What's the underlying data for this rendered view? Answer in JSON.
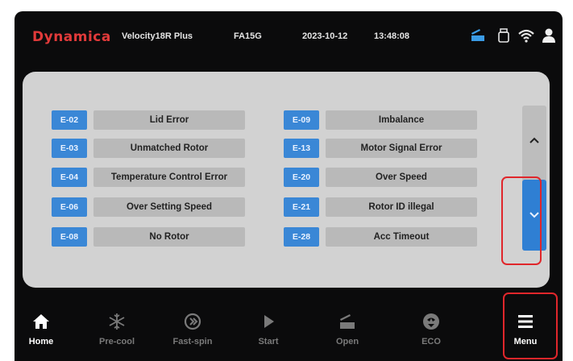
{
  "status_bar": {
    "brand": "Dynamica",
    "model": "Velocity18R Plus",
    "rotor": "FA15G",
    "date": "2023-10-12",
    "time": "13:48:08",
    "icons": [
      "lid-open-icon",
      "usb-icon",
      "wifi-icon",
      "user-icon"
    ]
  },
  "errors": {
    "left": [
      {
        "code": "E-02",
        "label": "Lid Error"
      },
      {
        "code": "E-03",
        "label": "Unmatched Rotor"
      },
      {
        "code": "E-04",
        "label": "Temperature Control Error"
      },
      {
        "code": "E-06",
        "label": "Over Setting Speed"
      },
      {
        "code": "E-08",
        "label": "No Rotor"
      }
    ],
    "right": [
      {
        "code": "E-09",
        "label": "Imbalance"
      },
      {
        "code": "E-13",
        "label": "Motor Signal Error"
      },
      {
        "code": "E-20",
        "label": "Over Speed"
      },
      {
        "code": "E-21",
        "label": "Rotor ID illegal"
      },
      {
        "code": "E-28",
        "label": "Acc Timeout"
      }
    ]
  },
  "scroll": {
    "up_icon": "chevron-up-icon",
    "down_icon": "chevron-down-icon"
  },
  "nav": [
    {
      "label": "Home",
      "icon": "home-icon",
      "active": true
    },
    {
      "label": "Pre-cool",
      "icon": "snowflake-icon",
      "active": false
    },
    {
      "label": "Fast-spin",
      "icon": "fast-spin-icon",
      "active": false
    },
    {
      "label": "Start",
      "icon": "play-icon",
      "active": false
    },
    {
      "label": "Open",
      "icon": "lid-open-icon",
      "active": false
    },
    {
      "label": "ECO",
      "icon": "eco-icon",
      "active": false
    },
    {
      "label": "Menu",
      "icon": "menu-icon",
      "active": true
    }
  ],
  "colors": {
    "accent": "#3a87d6",
    "highlight": "#e0262b",
    "background": "#0b0b0c",
    "panel": "#d2d2d2"
  }
}
